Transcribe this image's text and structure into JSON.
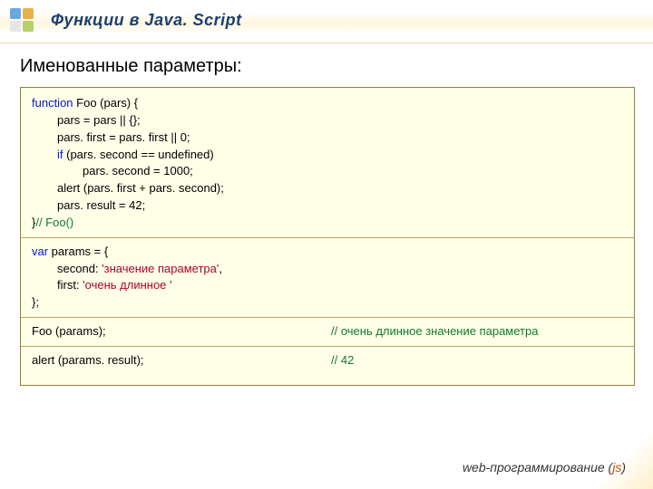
{
  "header": {
    "title": "Функции в Java. Script"
  },
  "subtitle": "Именованные параметры:",
  "code": {
    "fn_decl_kw": "function",
    "fn_decl_rest": " Foo (pars) {",
    "l1": "pars = pars || {};",
    "l2": "pars. first = pars. first || 0;",
    "l3_kw": "if",
    "l3_rest": " (pars. second == undefined)",
    "l4": "pars. second = 1000;",
    "l5": "alert (pars. first + pars. second);",
    "l6": "pars. result = 42;",
    "l7_close": "}",
    "l7_cm": "// Foo()",
    "var_kw": "var",
    "var_rest": " params = {",
    "p1a": "second: ",
    "p1s": "'значение параметра'",
    "p1c": ",",
    "p2a": "first: ",
    "p2s": "'очень длинное '",
    "pclose": "};",
    "call1": "Foo (params);",
    "call1_cm": "// очень длинное значение параметра",
    "call2": "alert (params. result);",
    "call2_cm": "// 42"
  },
  "footer": {
    "text": "web-программирование (",
    "js": "js",
    "close": ")"
  }
}
